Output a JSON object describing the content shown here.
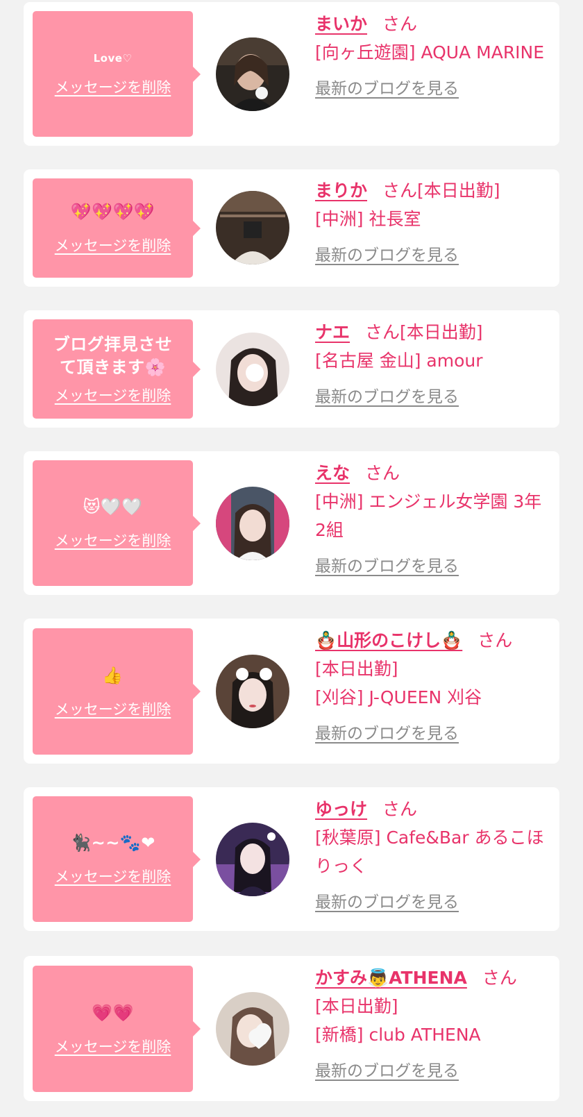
{
  "delete_label": "メッセージを削除",
  "blog_label": "最新のブログを見る",
  "san_label": "さん",
  "colors": {
    "accent": "#e8336a",
    "bubble": "#ff95a8",
    "muted": "#8a8a8a",
    "background": "#f2f2f2"
  },
  "cards": [
    {
      "message": "Love♡",
      "name": "まいか",
      "status": "",
      "shop": "[向ヶ丘遊園] AQUA MARINE",
      "avatar_icon": "girl-photo-icon"
    },
    {
      "message": "💖💖💖💖",
      "name": "まりか",
      "status": "[本日出勤]",
      "shop": "[中洲] 社長室",
      "avatar_icon": "girl-photo-icon"
    },
    {
      "message": "ブログ拝見させて頂きます🌸",
      "name": "ナエ",
      "status": "[本日出勤]",
      "shop": "[名古屋 金山] amour",
      "avatar_icon": "girl-photo-icon"
    },
    {
      "message": "😻🤍🤍",
      "name": "えな",
      "status": "",
      "shop": "[中洲] エンジェル女学園 3年2組",
      "avatar_icon": "girl-photo-icon"
    },
    {
      "message": "👍",
      "name": "🪆山形のこけし🪆",
      "status": "[本日出勤]",
      "shop": "[刈谷] J-QUEEN 刈谷",
      "avatar_icon": "girl-photo-icon"
    },
    {
      "message": "🐈‍⬛~~🐾❤",
      "name": "ゆっけ",
      "status": "",
      "shop": "[秋葉原] Cafe&Bar あるこほりっく",
      "avatar_icon": "girl-photo-icon"
    },
    {
      "message": "💗💗",
      "name": "かすみ👼ATHENA",
      "status": "[本日出勤]",
      "shop": "[新橋] club ATHENA",
      "avatar_icon": "girl-photo-icon"
    }
  ]
}
